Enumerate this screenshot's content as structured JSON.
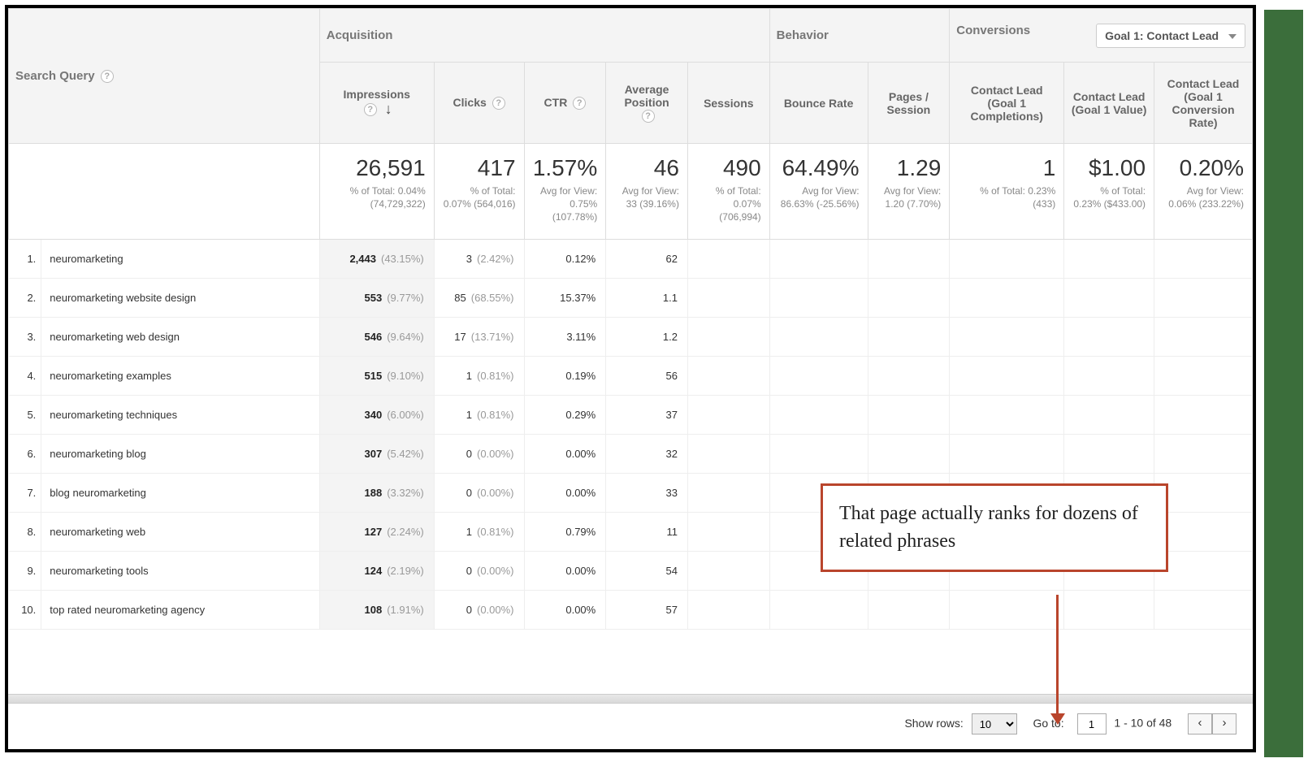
{
  "columns": {
    "search_query": "Search Query",
    "group_acq": "Acquisition",
    "group_beh": "Behavior",
    "group_conv": "Conversions",
    "goal_select": "Goal 1: Contact Lead",
    "impressions": "Impressions",
    "clicks": "Clicks",
    "ctr": "CTR",
    "avg_position": "Average Position",
    "sessions": "Sessions",
    "bounce_rate": "Bounce Rate",
    "pages_session": "Pages / Session",
    "goal_completions": "Contact Lead (Goal 1 Completions)",
    "goal_value": "Contact Lead (Goal 1 Value)",
    "goal_rate": "Contact Lead (Goal 1 Conversion Rate)"
  },
  "summary": {
    "impressions": {
      "big": "26,591",
      "sub": "% of Total: 0.04% (74,729,322)"
    },
    "clicks": {
      "big": "417",
      "sub": "% of Total: 0.07% (564,016)"
    },
    "ctr": {
      "big": "1.57%",
      "sub": "Avg for View: 0.75% (107.78%)"
    },
    "avg_position": {
      "big": "46",
      "sub": "Avg for View: 33 (39.16%)"
    },
    "sessions": {
      "big": "490",
      "sub": "% of Total: 0.07% (706,994)"
    },
    "bounce_rate": {
      "big": "64.49%",
      "sub": "Avg for View: 86.63% (-25.56%)"
    },
    "pages_session": {
      "big": "1.29",
      "sub": "Avg for View: 1.20 (7.70%)"
    },
    "goal_completions": {
      "big": "1",
      "sub": "% of Total: 0.23% (433)"
    },
    "goal_value": {
      "big": "$1.00",
      "sub": "% of Total: 0.23% ($433.00)"
    },
    "goal_rate": {
      "big": "0.20%",
      "sub": "Avg for View: 0.06% (233.22%)"
    }
  },
  "rows": [
    {
      "n": "1.",
      "query": "neuromarketing",
      "imp": "2,443",
      "imp_pct": "(43.15%)",
      "clicks": "3",
      "clicks_pct": "(2.42%)",
      "ctr": "0.12%",
      "pos": "62"
    },
    {
      "n": "2.",
      "query": "neuromarketing website design",
      "imp": "553",
      "imp_pct": "(9.77%)",
      "clicks": "85",
      "clicks_pct": "(68.55%)",
      "ctr": "15.37%",
      "pos": "1.1"
    },
    {
      "n": "3.",
      "query": "neuromarketing web design",
      "imp": "546",
      "imp_pct": "(9.64%)",
      "clicks": "17",
      "clicks_pct": "(13.71%)",
      "ctr": "3.11%",
      "pos": "1.2"
    },
    {
      "n": "4.",
      "query": "neuromarketing examples",
      "imp": "515",
      "imp_pct": "(9.10%)",
      "clicks": "1",
      "clicks_pct": "(0.81%)",
      "ctr": "0.19%",
      "pos": "56"
    },
    {
      "n": "5.",
      "query": "neuromarketing techniques",
      "imp": "340",
      "imp_pct": "(6.00%)",
      "clicks": "1",
      "clicks_pct": "(0.81%)",
      "ctr": "0.29%",
      "pos": "37"
    },
    {
      "n": "6.",
      "query": "neuromarketing blog",
      "imp": "307",
      "imp_pct": "(5.42%)",
      "clicks": "0",
      "clicks_pct": "(0.00%)",
      "ctr": "0.00%",
      "pos": "32"
    },
    {
      "n": "7.",
      "query": "blog neuromarketing",
      "imp": "188",
      "imp_pct": "(3.32%)",
      "clicks": "0",
      "clicks_pct": "(0.00%)",
      "ctr": "0.00%",
      "pos": "33"
    },
    {
      "n": "8.",
      "query": "neuromarketing web",
      "imp": "127",
      "imp_pct": "(2.24%)",
      "clicks": "1",
      "clicks_pct": "(0.81%)",
      "ctr": "0.79%",
      "pos": "11"
    },
    {
      "n": "9.",
      "query": "neuromarketing tools",
      "imp": "124",
      "imp_pct": "(2.19%)",
      "clicks": "0",
      "clicks_pct": "(0.00%)",
      "ctr": "0.00%",
      "pos": "54"
    },
    {
      "n": "10.",
      "query": "top rated neuromarketing agency",
      "imp": "108",
      "imp_pct": "(1.91%)",
      "clicks": "0",
      "clicks_pct": "(0.00%)",
      "ctr": "0.00%",
      "pos": "57"
    }
  ],
  "pager": {
    "show_rows_label": "Show rows:",
    "show_rows_value": "10",
    "goto_label": "Go to:",
    "goto_value": "1",
    "range": "1 - 10 of 48"
  },
  "annotation": "That page actually ranks for dozens of related phrases"
}
